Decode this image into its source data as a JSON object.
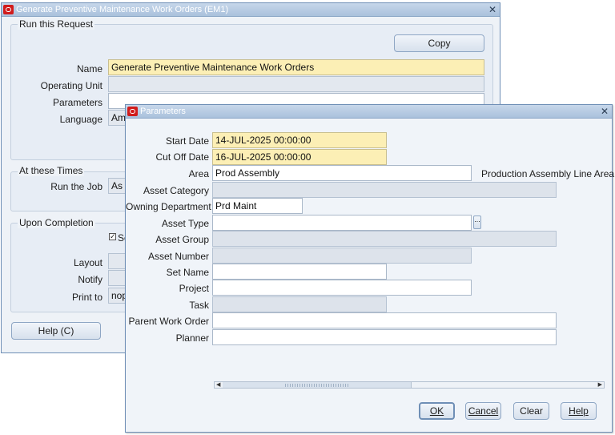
{
  "main_window": {
    "title": "Generate Preventive Maintenance Work Orders (EM1)",
    "run_request": {
      "group_label": "Run this Request",
      "copy_button": "Copy",
      "name_label": "Name",
      "name_value": "Generate Preventive Maintenance Work Orders",
      "operating_unit_label": "Operating Unit",
      "operating_unit_value": "",
      "parameters_label": "Parameters",
      "parameters_value": "",
      "language_label": "Language",
      "language_value": "Ame"
    },
    "schedule": {
      "group_label": "At these Times",
      "run_job_label": "Run the Job",
      "run_job_value": "As S"
    },
    "completion": {
      "group_label": "Upon Completion",
      "save_checkbox_text": "Se",
      "save_checked": true,
      "layout_label": "Layout",
      "notify_label": "Notify",
      "print_to_label": "Print to",
      "print_to_value": "nop"
    },
    "help_button": "Help (C)"
  },
  "params_window": {
    "title": "Parameters",
    "fields": {
      "start_date": {
        "label": "Start Date",
        "value": "14-JUL-2025 00:00:00"
      },
      "cut_off_date": {
        "label": "Cut Off Date",
        "value": "16-JUL-2025 00:00:00"
      },
      "area": {
        "label": "Area",
        "value": "Prod Assembly",
        "description": "Production Assembly Line Area"
      },
      "asset_category": {
        "label": "Asset Category",
        "value": ""
      },
      "owning_department": {
        "label": "Owning Department",
        "value": "Prd Maint"
      },
      "asset_type": {
        "label": "Asset Type",
        "value": ""
      },
      "asset_group": {
        "label": "Asset Group",
        "value": ""
      },
      "asset_number": {
        "label": "Asset Number",
        "value": ""
      },
      "set_name": {
        "label": "Set Name",
        "value": ""
      },
      "project": {
        "label": "Project",
        "value": ""
      },
      "task": {
        "label": "Task",
        "value": ""
      },
      "parent_work_order": {
        "label": "Parent Work Order",
        "value": ""
      },
      "planner": {
        "label": "Planner",
        "value": ""
      }
    },
    "buttons": {
      "ok": "OK",
      "cancel": "Cancel",
      "clear": "Clear",
      "help": "Help"
    },
    "lov_button": "..."
  },
  "colors": {
    "required_field": "#fcefb5",
    "window_bg": "#eef2f7",
    "titlebar": "#a9c1dc",
    "oracle_icon": "#d11c1c"
  },
  "icons": {
    "window_icon": "oracle-o-icon",
    "close": "close-icon"
  }
}
